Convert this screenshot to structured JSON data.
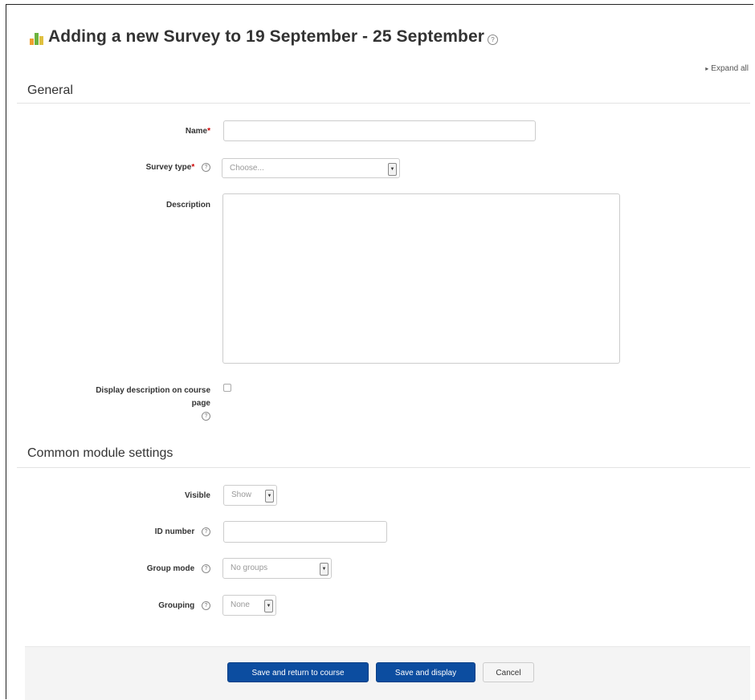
{
  "page": {
    "title": "Adding a new Survey to 19 September - 25 September",
    "expand_all": "Expand all"
  },
  "sections": {
    "general": "General",
    "common": "Common module settings"
  },
  "fields": {
    "name_label": "Name",
    "name_value": "",
    "survey_type_label": "Survey type",
    "survey_type_value": "Choose...",
    "description_label": "Description",
    "description_value": "",
    "display_desc_label_1": "Display description on course",
    "display_desc_label_2": "page",
    "display_desc_checked": false,
    "visible_label": "Visible",
    "visible_value": "Show",
    "idnumber_label": "ID number",
    "idnumber_value": "",
    "groupmode_label": "Group mode",
    "groupmode_value": "No groups",
    "grouping_label": "Grouping",
    "grouping_value": "None"
  },
  "required_mark": "*",
  "help_glyph": "?",
  "buttons": {
    "save_return": "Save and return to course",
    "save_display": "Save and display",
    "cancel": "Cancel"
  },
  "colors": {
    "primary_button": "#0c4da0",
    "required": "#cc0000"
  },
  "icons": {
    "logo": "survey-chart-icon",
    "help": "help-circle-icon",
    "expand": "expand-triangle-icon",
    "dropdown": "dropdown-arrow-icon"
  }
}
